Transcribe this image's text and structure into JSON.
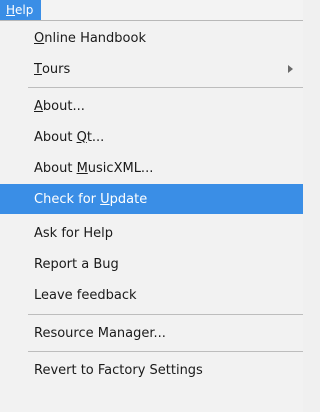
{
  "menu": {
    "title": {
      "mnemonic": "H",
      "rest": "elp"
    }
  },
  "items": [
    {
      "mnemonic": "O",
      "rest": "nline Handbook"
    },
    {
      "mnemonic": "T",
      "rest": "ours",
      "submenu": true
    },
    {
      "mnemonic": "A",
      "rest": "bout..."
    },
    {
      "pre": "About ",
      "mnemonic": "Q",
      "rest": "t..."
    },
    {
      "pre": "About ",
      "mnemonic": "M",
      "rest": "usicXML..."
    },
    {
      "pre": "Check for ",
      "mnemonic": "U",
      "rest": "pdate",
      "highlighted": true
    },
    {
      "label": "Ask for Help"
    },
    {
      "label": "Report a Bug"
    },
    {
      "label": "Leave feedback"
    },
    {
      "label": "Resource Manager..."
    },
    {
      "label": "Revert to Factory Settings"
    }
  ],
  "colors": {
    "highlight": "#3a8ee6",
    "menu_bg": "#f2f2f2",
    "separator": "#bdbdbd"
  }
}
